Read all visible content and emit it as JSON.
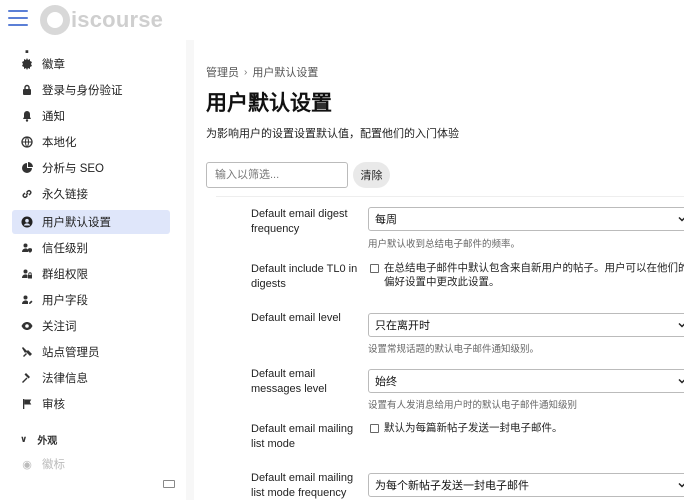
{
  "header": {
    "logo_text": "iscourse"
  },
  "sidebar": {
    "items": [
      {
        "label": "徽章"
      },
      {
        "label": "登录与身份验证"
      },
      {
        "label": "通知"
      },
      {
        "label": "本地化"
      },
      {
        "label": "分析与 SEO"
      },
      {
        "label": "永久链接"
      },
      {
        "label": "用户默认设置"
      },
      {
        "label": "信任级别"
      },
      {
        "label": "群组权限"
      },
      {
        "label": "用户字段"
      },
      {
        "label": "关注词"
      },
      {
        "label": "站点管理员"
      },
      {
        "label": "法律信息"
      },
      {
        "label": "审核"
      }
    ],
    "section": "外观",
    "faded_item": "徽标"
  },
  "main": {
    "breadcrumb": {
      "root": "管理员",
      "current": "用户默认设置"
    },
    "title": "用户默认设置",
    "description": "为影响用户的设置设置默认值，配置他们的入门体验",
    "filter_placeholder": "输入以筛选...",
    "clear_label": "清除",
    "settings": [
      {
        "label": "Default email digest frequency",
        "value": "每周",
        "help": "用户默认收到总结电子邮件的频率。"
      },
      {
        "label": "Default include TL0 in digests",
        "check_text": "在总结电子邮件中默认包含来自新用户的帖子。用户可以在他们的偏好设置中更改此设置。"
      },
      {
        "label": "Default email level",
        "value": "只在离开时",
        "help": "设置常规话题的默认电子邮件通知级别。"
      },
      {
        "label": "Default email messages level",
        "value": "始终",
        "help": "设置有人发消息给用户时的默认电子邮件通知级别"
      },
      {
        "label": "Default email mailing list mode",
        "check_text": "默认为每篇新帖子发送一封电子邮件。"
      },
      {
        "label": "Default email mailing list mode frequency",
        "value": "为每个新帖子发送一封电子邮件"
      }
    ]
  },
  "colors": {
    "accent": "#5b7fd6",
    "active_bg": "#dfe6fa"
  }
}
